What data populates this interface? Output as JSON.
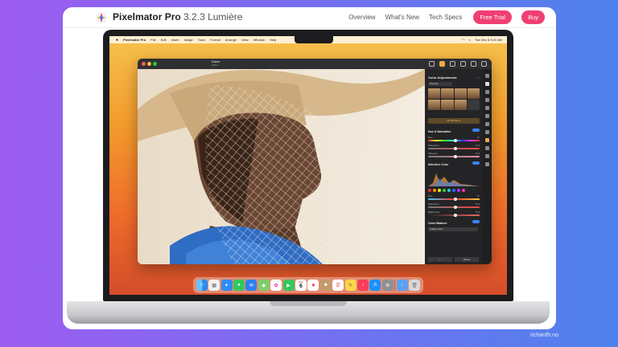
{
  "nav": {
    "brand": "Pixelmator Pro",
    "version": "3.2.3 Lumière",
    "links": [
      "Overview",
      "What's New",
      "Tech Specs"
    ],
    "cta_trial": "Free Trial",
    "cta_buy": "Buy",
    "accent_color": "#ef3f73"
  },
  "menubar": {
    "app": "Pixelmator Pro",
    "items": [
      "File",
      "Edit",
      "Insert",
      "Image",
      "Tools",
      "Format",
      "Arrange",
      "View",
      "Window",
      "Help"
    ],
    "clock": "Tue Dec 6 9:41 AM"
  },
  "app_window": {
    "doc_title": "Diane",
    "doc_subtitle": "Edited"
  },
  "panel": {
    "title": "Color Adjustments",
    "preset": "Presets",
    "ml_button": "ML Enhance",
    "section_hue": "Hue & Saturation",
    "hue_label": "Hue",
    "hue_value": "0°",
    "saturation_label": "Saturation",
    "saturation_value": "0 %",
    "vibrance_label": "Vibrance",
    "vibrance_value": "0 %",
    "section_selective": "Selective Color",
    "sel_hue_label": "Hue",
    "sel_hue_value": "0°",
    "sel_sat_label": "Saturation",
    "sel_sat_value": "0 %",
    "sel_bri_label": "Brightness",
    "sel_bri_value": "0 %",
    "section_balance": "Color Balance",
    "balance_mode": "3-Way Color",
    "reset_label": "Reset"
  },
  "credit": "richardh.no"
}
